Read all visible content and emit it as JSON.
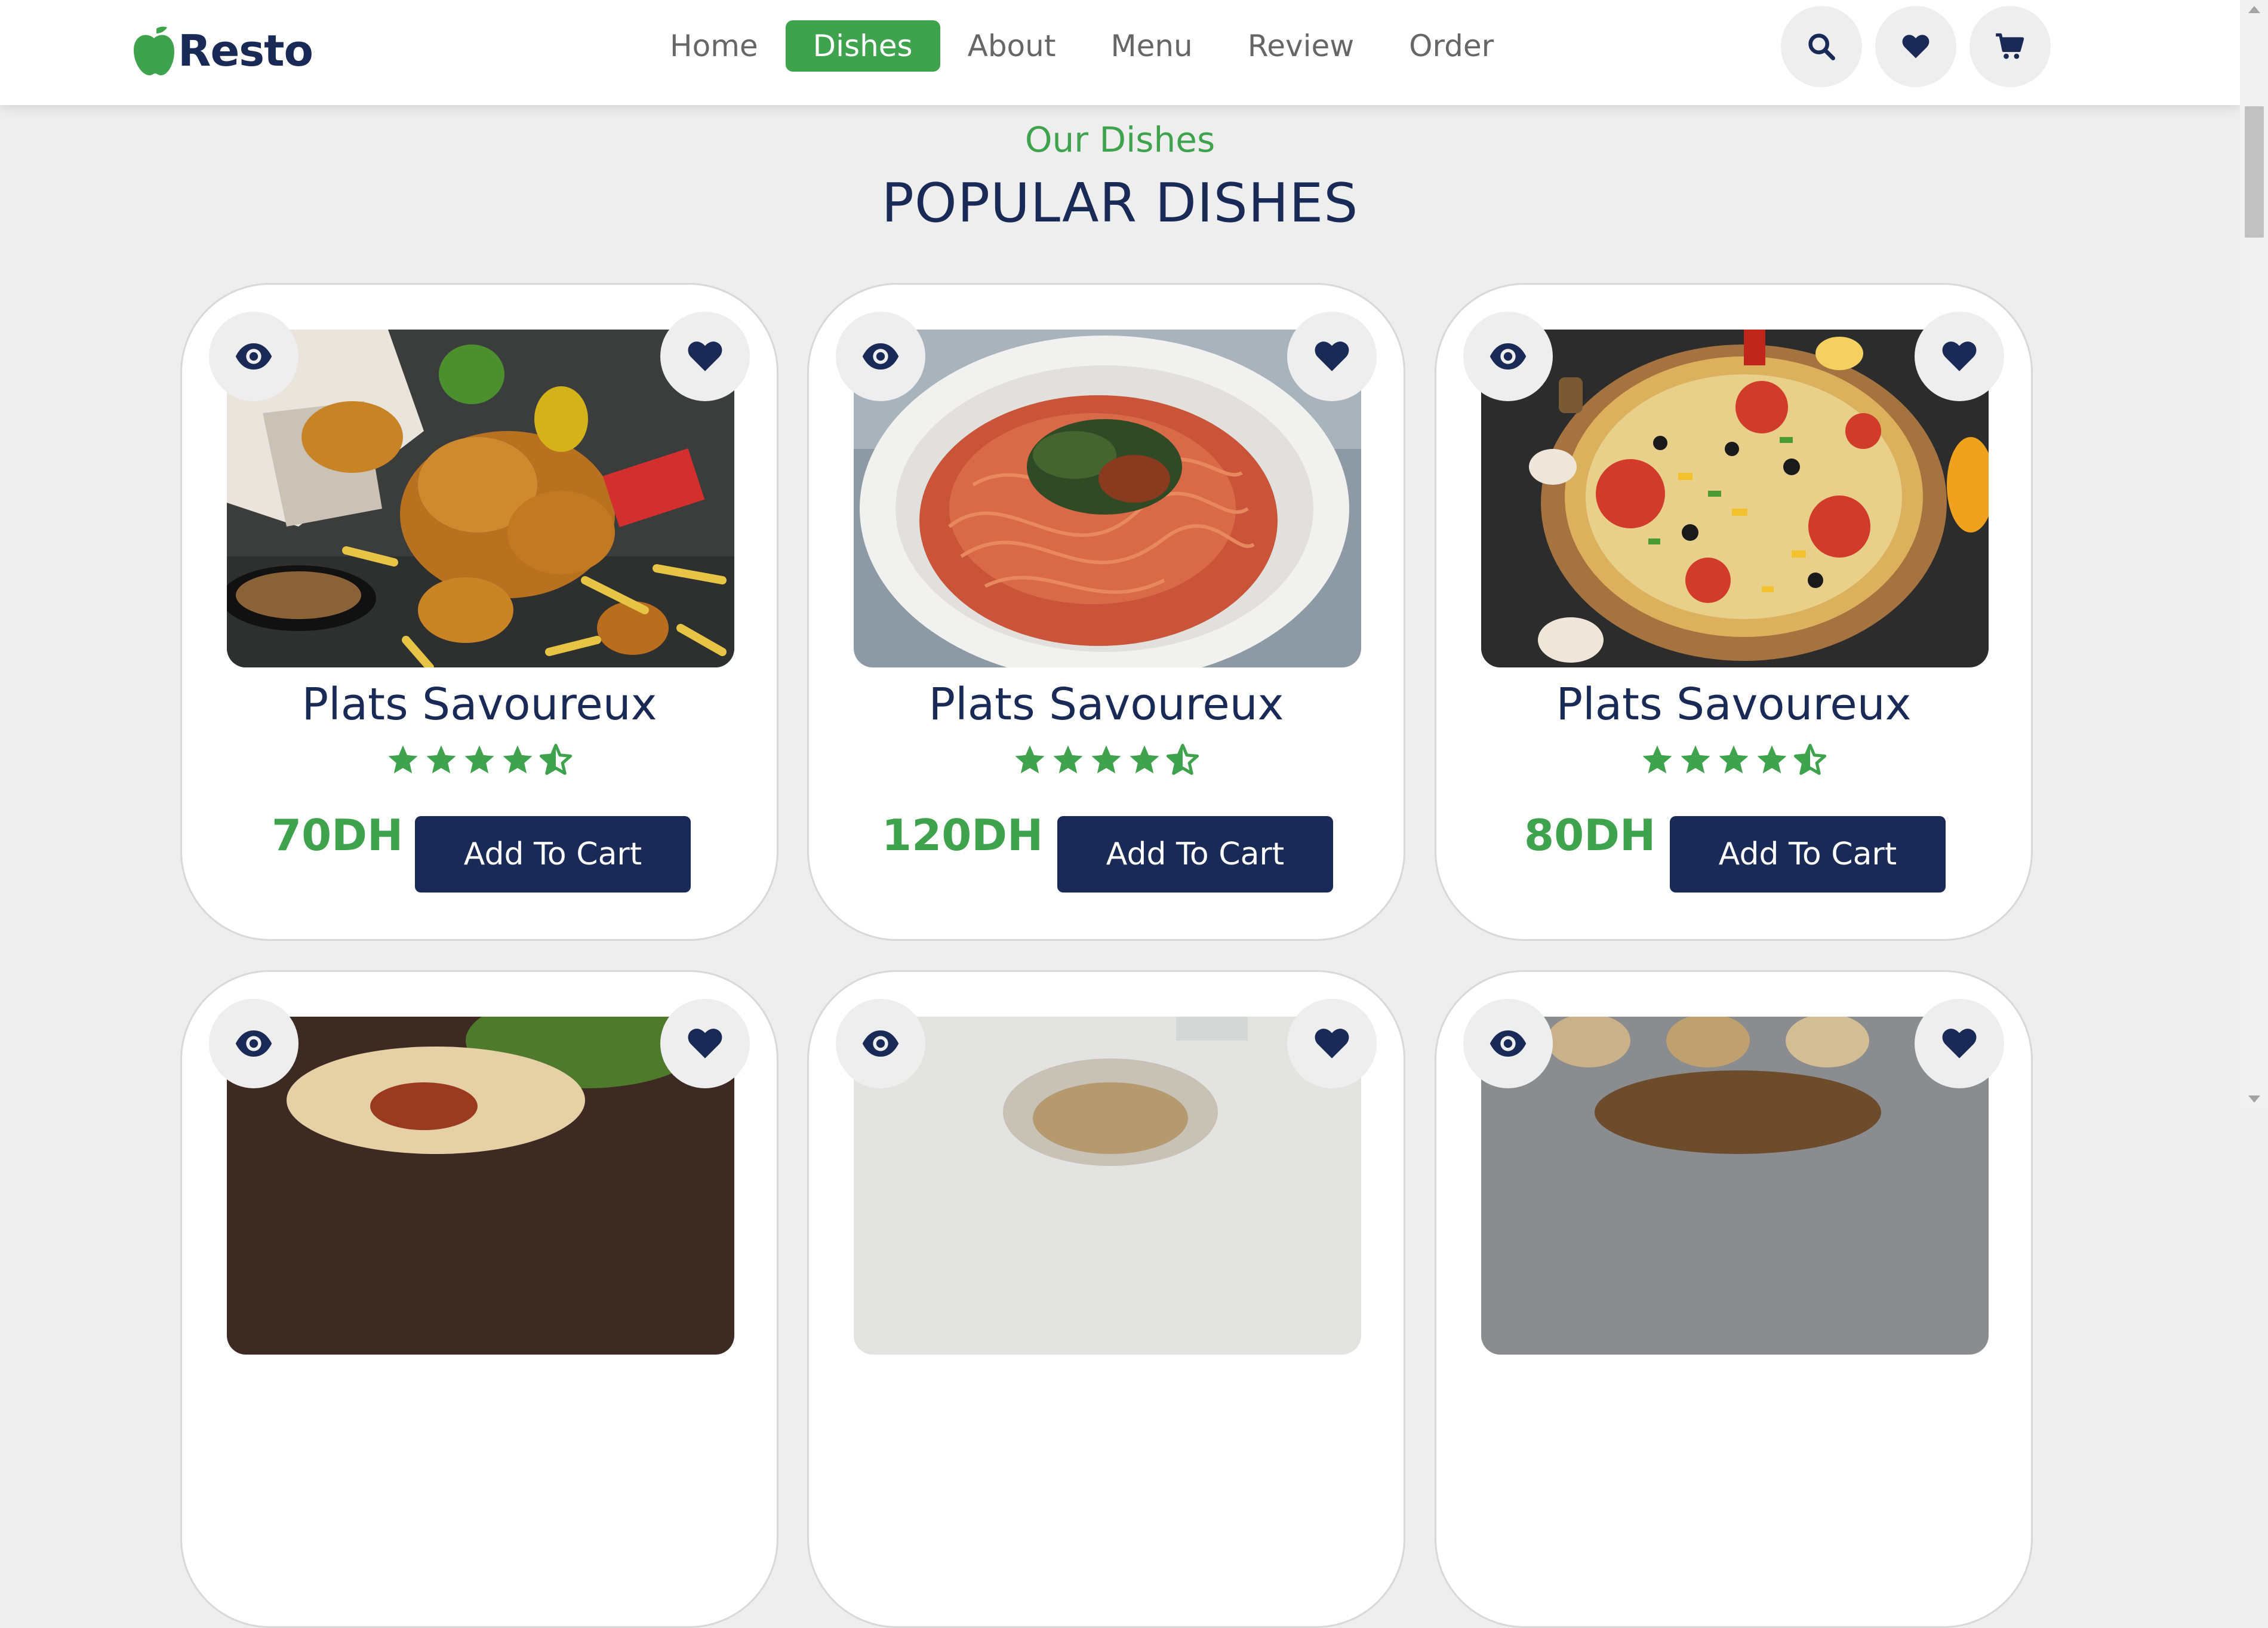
{
  "brand": {
    "name": "Resto"
  },
  "nav": {
    "items": [
      {
        "label": "Home"
      },
      {
        "label": "Dishes"
      },
      {
        "label": "About"
      },
      {
        "label": "Menu"
      },
      {
        "label": "Review"
      },
      {
        "label": "Order"
      }
    ],
    "active": "Dishes"
  },
  "header_icons": [
    "search-icon",
    "heart-icon",
    "cart-icon"
  ],
  "section": {
    "subtitle": "Our Dishes",
    "title": "POPULAR DISHES"
  },
  "dishes": [
    {
      "name": "Plats Savoureux",
      "price": "70DH",
      "cta": "Add To Cart",
      "rating": 4.5,
      "image": "fried chicken"
    },
    {
      "name": "Plats Savoureux",
      "price": "120DH",
      "cta": "Add To Cart",
      "rating": 4.5,
      "image": "spaghetti"
    },
    {
      "name": "Plats Savoureux",
      "price": "80DH",
      "cta": "Add To Cart",
      "rating": 4.5,
      "image": "pizza"
    }
  ],
  "colors": {
    "accent": "#3fa34d",
    "navy": "#1a2a56",
    "background": "#eeeeee"
  }
}
